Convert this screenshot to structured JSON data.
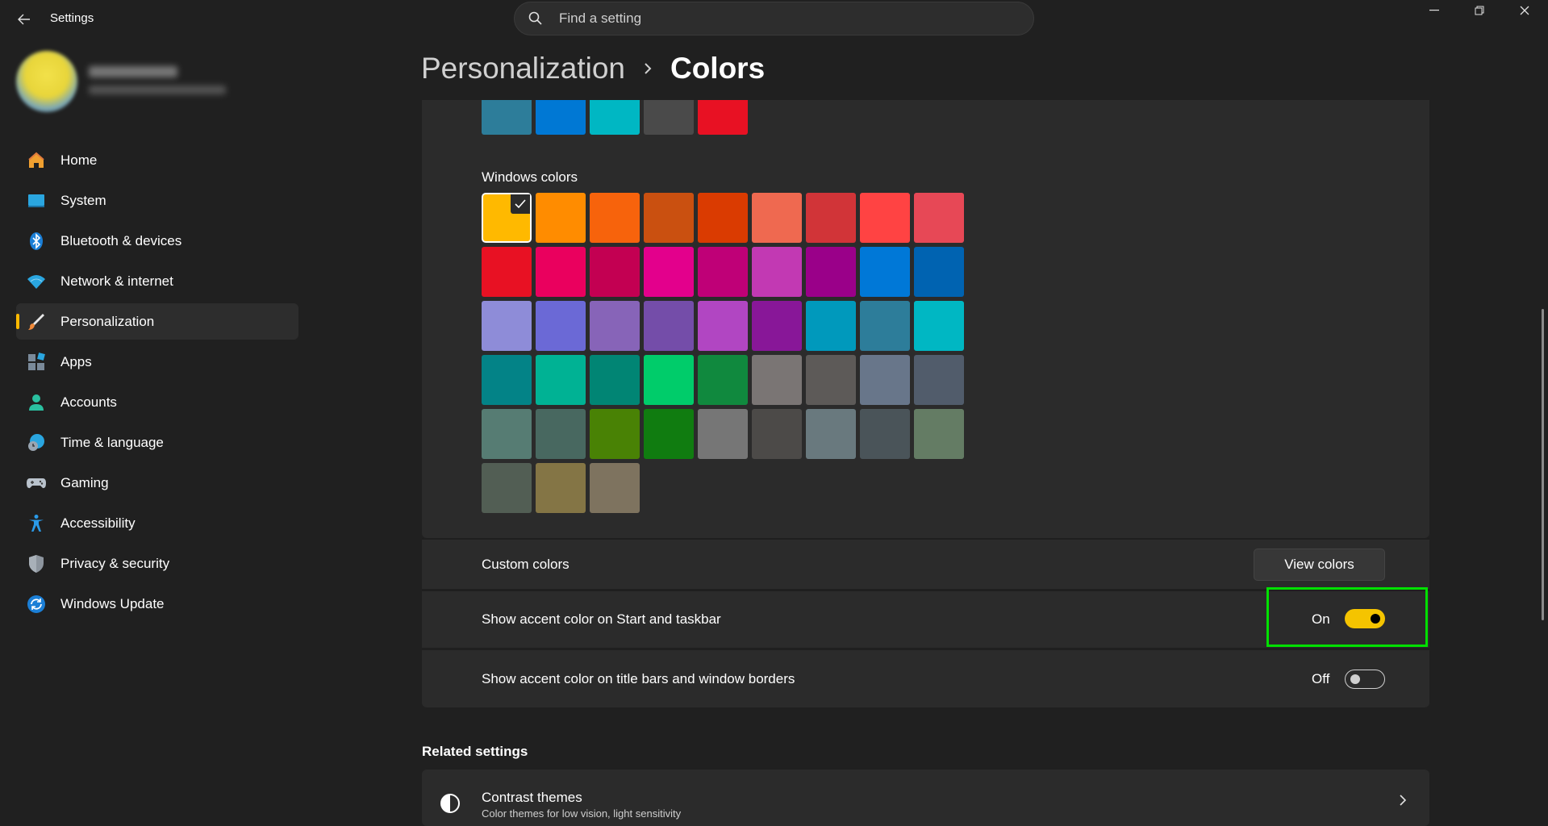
{
  "titlebar": {
    "app_title": "Settings",
    "search_placeholder": "Find a setting"
  },
  "sidebar": {
    "items": [
      {
        "label": "Home",
        "icon": "home-icon"
      },
      {
        "label": "System",
        "icon": "system-icon"
      },
      {
        "label": "Bluetooth & devices",
        "icon": "bluetooth-icon"
      },
      {
        "label": "Network & internet",
        "icon": "wifi-icon"
      },
      {
        "label": "Personalization",
        "icon": "brush-icon",
        "active": true
      },
      {
        "label": "Apps",
        "icon": "apps-icon"
      },
      {
        "label": "Accounts",
        "icon": "accounts-icon"
      },
      {
        "label": "Time & language",
        "icon": "time-language-icon"
      },
      {
        "label": "Gaming",
        "icon": "gamepad-icon"
      },
      {
        "label": "Accessibility",
        "icon": "accessibility-icon"
      },
      {
        "label": "Privacy & security",
        "icon": "shield-icon"
      },
      {
        "label": "Windows Update",
        "icon": "update-icon"
      }
    ]
  },
  "header": {
    "parent": "Personalization",
    "current": "Colors"
  },
  "recent_colors": [
    "#2d7d9a",
    "#0078d4",
    "#00b7c3",
    "#4a4a4a",
    "#e81123"
  ],
  "windows_colors": {
    "label": "Windows colors",
    "selected_index": 0,
    "colors": [
      "#ffb900",
      "#ff8c00",
      "#f7630c",
      "#ca5010",
      "#da3b01",
      "#ef6950",
      "#d13438",
      "#ff4343",
      "#e74856",
      "#e81123",
      "#ea005e",
      "#c30052",
      "#e3008c",
      "#bf0077",
      "#c239b3",
      "#9a0089",
      "#0078d7",
      "#0063b1",
      "#8e8cd8",
      "#6b69d6",
      "#8764b8",
      "#744da9",
      "#b146c2",
      "#881798",
      "#0099bc",
      "#2d7d9a",
      "#00b7c3",
      "#038387",
      "#00b294",
      "#018574",
      "#00cc6a",
      "#10893e",
      "#7a7574",
      "#5d5a58",
      "#68768a",
      "#515c6b",
      "#567c73",
      "#486860",
      "#498205",
      "#107c10",
      "#767676",
      "#4c4a48",
      "#69797e",
      "#4a5459",
      "#647c64",
      "#525e54",
      "#847545",
      "#7e735f"
    ]
  },
  "custom_colors": {
    "label": "Custom colors",
    "button": "View colors"
  },
  "accent_start_taskbar": {
    "label": "Show accent color on Start and taskbar",
    "state": "On"
  },
  "accent_title_bars": {
    "label": "Show accent color on title bars and window borders",
    "state": "Off"
  },
  "related": {
    "title": "Related settings",
    "contrast_title": "Contrast themes",
    "contrast_sub": "Color themes for low vision, light sensitivity"
  },
  "colors": {
    "accent": "#ffb900",
    "highlight": "#00e000",
    "background": "#202020",
    "card": "#2b2b2b"
  }
}
